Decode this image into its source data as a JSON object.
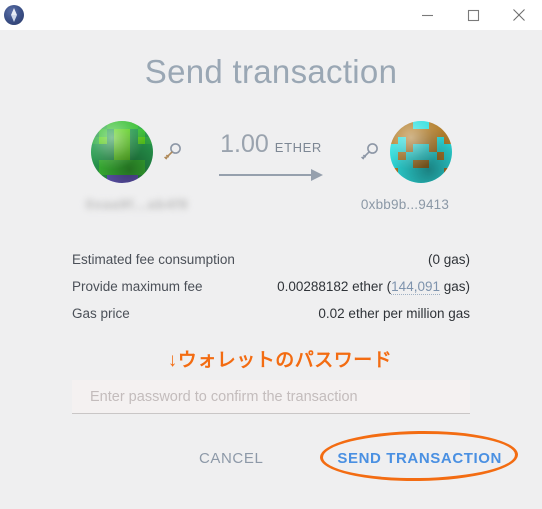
{
  "window": {
    "app_icon": "ethereum-logo-icon",
    "controls": {
      "minimize": "minimize-icon",
      "maximize": "maximize-icon",
      "close": "close-icon"
    }
  },
  "header": {
    "title": "Send transaction"
  },
  "transfer": {
    "sender": {
      "address": "0xaa9f...ab4f9",
      "redacted": true,
      "identicon_colors": [
        "#3bbf3b",
        "#2aa052",
        "#5ed41f",
        "#6b5fc4"
      ],
      "key_icon": "key-icon"
    },
    "recipient": {
      "address": "0xbb9b...9413",
      "redacted": false,
      "identicon_colors": [
        "#b5812f",
        "#2fe0e0",
        "#35d6d6",
        "#a3752a"
      ],
      "key_icon": "key-icon"
    },
    "amount": "1.00",
    "currency": "ETHER",
    "direction_icon": "arrow-right-icon"
  },
  "fees": {
    "rows": [
      {
        "label": "Estimated fee consumption",
        "value_prefix": "",
        "value": "(0 gas)",
        "editable_value": "",
        "value_suffix": ""
      },
      {
        "label": "Provide maximum fee",
        "value_prefix": "0.00288182 ether (",
        "value": "",
        "editable_value": "144,091",
        "value_suffix": " gas)"
      },
      {
        "label": "Gas price",
        "value_prefix": "",
        "value": "0.02 ether per million gas",
        "editable_value": "",
        "value_suffix": ""
      }
    ]
  },
  "annotation": {
    "password_hint": "↓ウォレットのパスワード",
    "color": "#f36c12",
    "highlight_target": "send-transaction-button"
  },
  "password": {
    "value": "",
    "placeholder": "Enter password to confirm the transaction"
  },
  "actions": {
    "cancel_label": "CANCEL",
    "send_label": "SEND TRANSACTION",
    "send_color": "#4a90e2"
  }
}
